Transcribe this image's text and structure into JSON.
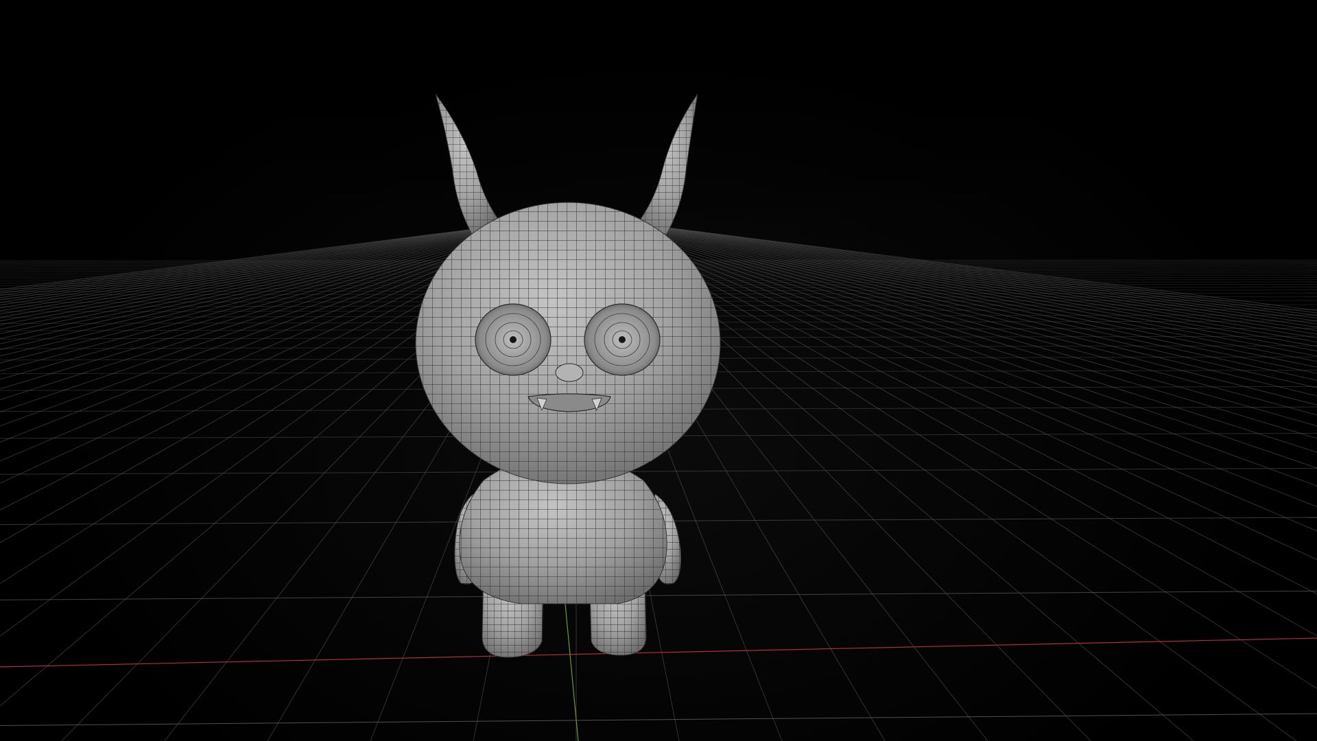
{
  "viewport": {
    "background_color": "#000000",
    "grid_color": "#5a5a5a",
    "x_axis_color": "#b0303a",
    "y_axis_color": "#6a9a3a",
    "model_color": "#9a9a9a",
    "wire_color": "#2a2a2a"
  },
  "model": {
    "description_icon": "wireframe-character-mesh"
  }
}
